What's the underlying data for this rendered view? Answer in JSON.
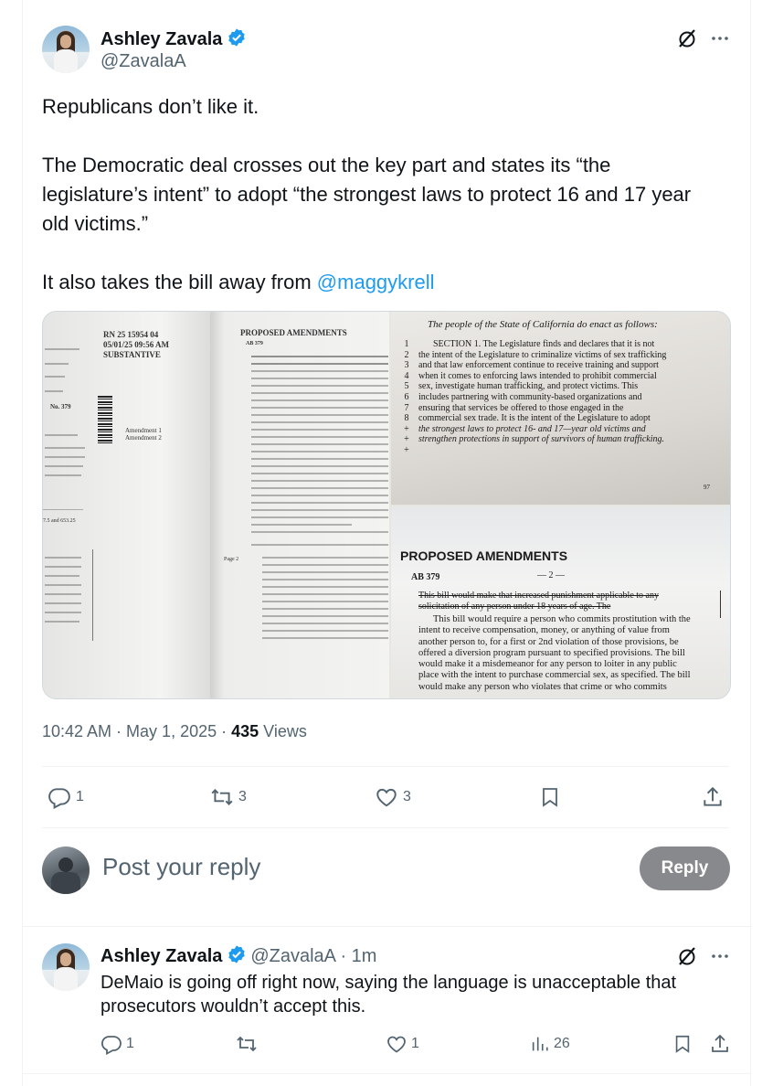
{
  "tweet": {
    "author_name": "Ashley Zavala",
    "author_handle": "@ZavalaA",
    "body": [
      "Republicans don’t like it.",
      "The Democratic deal crosses out the key part and states its “the legislature’s intent” to adopt “the strongest laws to protect 16 and 17 year old victims.”",
      "It also takes the bill away from "
    ],
    "mention": "@maggykrell",
    "timestamp": "10:42 AM · May 1, 2025 · ",
    "views_count": "435",
    "views_label": " Views",
    "replies": "1",
    "reposts": "3",
    "likes": "3"
  },
  "media": {
    "doc1": {
      "header": [
        "RN 25 15954 04",
        "05/01/25 09:56 AM",
        "SUBSTANTIVE"
      ],
      "amendments": [
        "Amendment 1",
        "Amendment 2"
      ],
      "title": "PROPOSED AMENDMENTS",
      "bill": "AB 379",
      "page_label": "Page 2",
      "side_labels": [
        "No. 379",
        "7.5 and 653.25"
      ]
    },
    "doc2": {
      "enact": "The people of the State of California do enact as follows:",
      "numbers": [
        "1",
        "2",
        "3",
        "4",
        "5",
        "6",
        "7",
        "8",
        "+",
        "+",
        "+"
      ],
      "lines": [
        "SECTION 1.  The Legislature finds and declares that it is not",
        "the intent of the Legislature to criminalize victims of sex trafficking",
        "and that law enforcement continue to receive training and support",
        "when it comes to enforcing laws intended to prohibit commercial",
        "sex, investigate human trafficking, and protect victims. This",
        "includes partnering with community-based organizations and",
        "ensuring that services be offered to those engaged in the",
        "commercial sex trade. It is the intent of the Legislature to adopt",
        "the strongest laws to protect 16- and 17—year old victims and",
        "strengthen protections in support of survivors of human trafficking."
      ],
      "page_number": "97"
    },
    "doc3": {
      "title": "PROPOSED AMENDMENTS",
      "bill": "AB 379",
      "page": "— 2 —",
      "struck": "This bill would make that increased punishment applicable to any solicitation of any person under 18 years of age. The",
      "lines": [
        "This bill would require a person who commits prostitution with the",
        "intent to receive compensation, money, or anything of value from",
        "another person to, for a first or 2nd violation of those provisions, be",
        "offered a diversion program pursuant to specified provisions. The bill",
        "would make it a misdemeanor for any person to loiter in any public",
        "place with the intent to purchase commercial sex, as specified. The bill",
        "would make any person who violates that crime or who commits"
      ]
    }
  },
  "reply_composer": {
    "placeholder": "Post your reply",
    "button": "Reply"
  },
  "reply": {
    "author_name": "Ashley Zavala",
    "author_handle": "@ZavalaA",
    "time": " · 1m",
    "body": "DeMaio is going off right now, saying the language is unacceptable that prosecutors wouldn’t accept this.",
    "replies": "1",
    "likes": "1",
    "views": "26"
  },
  "colors": {
    "accent": "#1d9bf0",
    "muted": "#536471",
    "reply_button": "#87898c"
  }
}
